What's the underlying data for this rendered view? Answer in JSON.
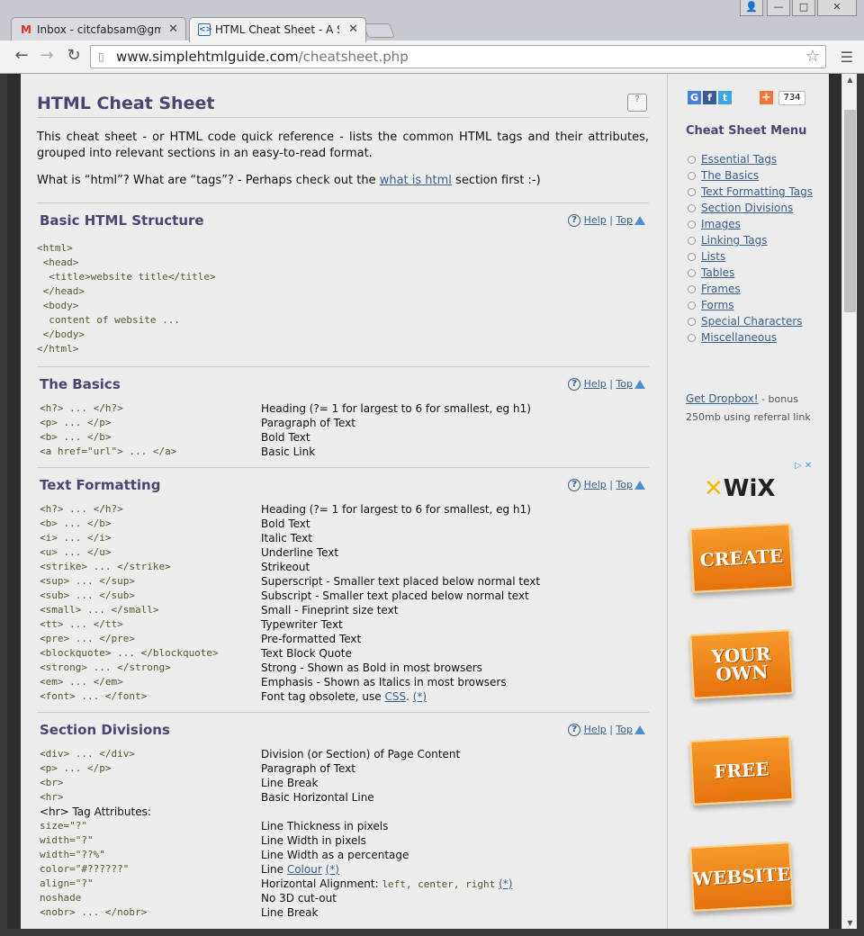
{
  "browser": {
    "tabs": [
      {
        "label": "Inbox - citcfabsam@gmail",
        "icon": "gmail-icon"
      },
      {
        "label": "HTML Cheat Sheet - A Sim",
        "icon": "code-icon"
      }
    ],
    "url_domain": "www.simplehtmlguide.com",
    "url_path": "/cheatsheet.php"
  },
  "page": {
    "title": "HTML Cheat Sheet",
    "intro": "This cheat sheet - or HTML code quick reference - lists the common HTML tags and their attributes, grouped into relevant sections in an easy-to-read format.",
    "intro2_pre": "What is “html”? What are “tags”? - Perhaps check out the ",
    "intro2_link": "what is html",
    "intro2_post": " section first :-)",
    "help_label": "Help",
    "top_label": "Top",
    "sections": [
      {
        "title": "Basic HTML Structure"
      },
      {
        "title": "The Basics"
      },
      {
        "title": "Text Formatting"
      },
      {
        "title": "Section Divisions"
      }
    ],
    "structure_code": "<html>\n <head>\n  <title>website title</title>\n </head>\n <body>\n  content of website ...\n </body>\n</html>",
    "basics": [
      {
        "code": "<h?> ... </h?>",
        "desc": "Heading (?= 1 for largest to 6 for smallest, eg h1)"
      },
      {
        "code": "<p> ... </p>",
        "desc": "Paragraph of Text"
      },
      {
        "code": "<b> ... </b>",
        "desc": "Bold Text"
      },
      {
        "code": "<a href=\"url\"> ... </a>",
        "desc": "Basic Link"
      }
    ],
    "formatting": [
      {
        "code": "<h?> ... </h?>",
        "desc": "Heading (?= 1 for largest to 6 for smallest, eg h1)"
      },
      {
        "code": "<b> ... </b>",
        "desc": "Bold Text"
      },
      {
        "code": "<i> ... </i>",
        "desc": "Italic Text"
      },
      {
        "code": "<u> ... </u>",
        "desc": "Underline Text"
      },
      {
        "code": "<strike> ... </strike>",
        "desc": "Strikeout"
      },
      {
        "code": "<sup> ... </sup>",
        "desc": "Superscript - Smaller text placed below normal text"
      },
      {
        "code": "<sub> ... </sub>",
        "desc": "Subscript - Smaller text placed below normal text"
      },
      {
        "code": "<small> ... </small>",
        "desc": "Small - Fineprint size text"
      },
      {
        "code": "<tt> ... </tt>",
        "desc": "Typewriter Text"
      },
      {
        "code": "<pre> ... </pre>",
        "desc": "Pre-formatted Text"
      },
      {
        "code": "<blockquote> ... </blockquote>",
        "desc": "Text Block Quote"
      },
      {
        "code": "<strong> ... </strong>",
        "desc": "Strong - Shown as Bold in most browsers"
      },
      {
        "code": "<em> ... </em>",
        "desc": "Emphasis - Shown as Italics in most browsers"
      },
      {
        "code": "<font> ... </font>",
        "desc": "Font tag obsolete, use ",
        "link": "CSS",
        "extra": ". ",
        "ref": "(*)"
      }
    ],
    "divisions": [
      {
        "code": "<div> ... </div>",
        "desc": "Division (or Section) of Page Content"
      },
      {
        "code": "<p> ... </p>",
        "desc": "Paragraph of Text"
      },
      {
        "code": "<br>",
        "desc": "Line Break"
      },
      {
        "code": "<hr>",
        "desc": "Basic Horizontal Line"
      },
      {
        "code": "<hr> Tag Attributes:",
        "desc": "",
        "plain": true
      },
      {
        "code": "   size=\"?\"",
        "desc": "Line Thickness in pixels"
      },
      {
        "code": "   width=\"?\"",
        "desc": "Line Width in pixels"
      },
      {
        "code": "   width=\"??%\"",
        "desc": "Line Width as a percentage"
      },
      {
        "code": "   color=\"#??????\"",
        "desc": "Line ",
        "link": "Colour",
        "extra": " ",
        "ref": "(*)"
      },
      {
        "code": "   align=\"?\"",
        "desc": "Horizontal Alignment: ",
        "mono": "left, center, right",
        "extra": " ",
        "ref": "(*)"
      },
      {
        "code": "   noshade",
        "desc": "No 3D cut-out"
      },
      {
        "code": "<nobr> ... </nobr>",
        "desc": "Line Break"
      }
    ]
  },
  "sidebar": {
    "share_count": "734",
    "menu_title": "Cheat Sheet Menu",
    "menu": [
      "Essential Tags",
      "The Basics",
      "Text Formatting Tags",
      "Section Divisions",
      "Images",
      "Linking Tags",
      "Lists",
      "Tables",
      "Frames",
      "Forms",
      "Special Characters",
      "Miscellaneous"
    ],
    "dropbox_link": "Get Dropbox!",
    "dropbox_text": " - bonus 250mb using referral link",
    "ad_brand": "WiX",
    "ad_buttons": [
      "CREATE",
      "YOUR OWN",
      "FREE",
      "WEBSITE"
    ]
  }
}
